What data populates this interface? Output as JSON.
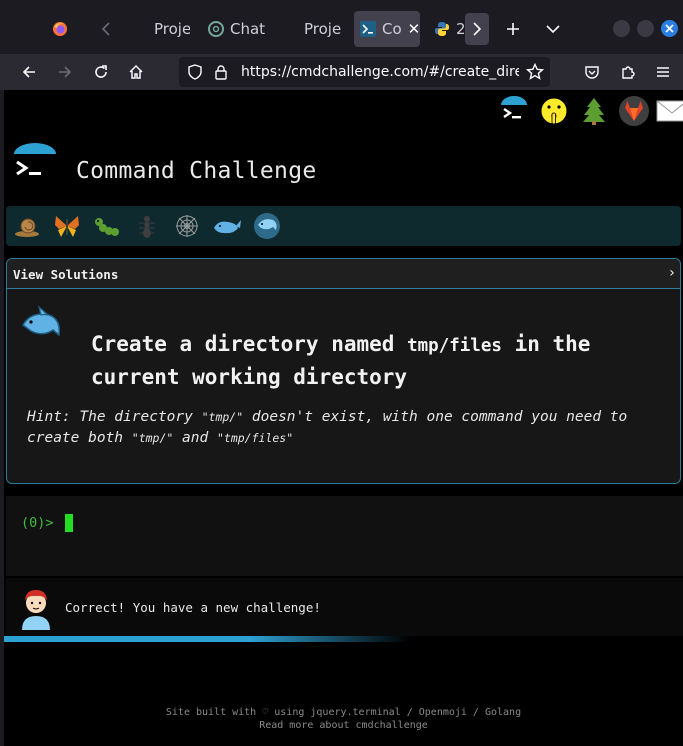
{
  "browser": {
    "tabs": [
      {
        "label": "",
        "icon": "firefox-icon",
        "active": false
      },
      {
        "label": "Proje",
        "icon": "",
        "active": false
      },
      {
        "label": "Chat",
        "icon": "chatgpt-icon",
        "active": false
      },
      {
        "label": "Proje",
        "icon": "",
        "active": false
      },
      {
        "label": "Co",
        "icon": "terminal-icon",
        "active": true
      },
      {
        "label": "2",
        "icon": "python-icon",
        "active": false
      }
    ],
    "url": "https://cmdchallenge.com/#/create_dire"
  },
  "site": {
    "title": "Command Challenge",
    "top_icons": [
      "cmdchallenge-icon",
      "shushing-face-icon",
      "tree-icon",
      "gitlab-icon",
      "envelope-icon"
    ],
    "challenge_bugs": [
      "snail-icon",
      "butterfly-icon",
      "caterpillar-icon",
      "ant-icon",
      "spider-web-icon",
      "whale-icon",
      "dolphin-icon"
    ]
  },
  "challenge": {
    "solutions_label": "View Solutions",
    "solutions_arrow": "›",
    "title_before": "Create a directory named",
    "title_code": "tmp/files",
    "title_after": "in the current working directory",
    "hint_prefix": "Hint: The directory ",
    "hint_code1": "\"tmp/\"",
    "hint_middle": " doesn't exist, with one command you need to create both ",
    "hint_code2": "\"tmp/\"",
    "hint_and": " and ",
    "hint_code3": "\"tmp/files\""
  },
  "terminal": {
    "prompt": "(0)>"
  },
  "message": {
    "text": "Correct! You have a new challenge!"
  },
  "progress": {
    "fraction": 0.6
  },
  "footer": {
    "line1": "Site built with ♡ using jquery.terminal / Openmoji / Golang",
    "line2": "Read more about cmdchallenge"
  },
  "colors": {
    "accent": "#2ea1d3",
    "prompt_green": "#3cbf3c",
    "border_blue": "#2b7d99"
  }
}
